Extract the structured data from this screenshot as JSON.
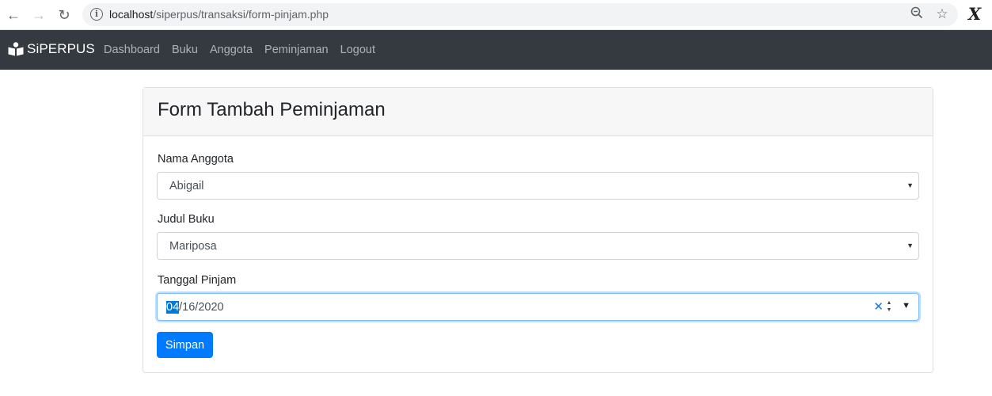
{
  "browser": {
    "url_host": "localhost",
    "url_path": "/siperpus/transaksi/form-pinjam.php"
  },
  "navbar": {
    "brand": "SiPERPUS",
    "links": [
      "Dashboard",
      "Buku",
      "Anggota",
      "Peminjaman",
      "Logout"
    ]
  },
  "form": {
    "title": "Form Tambah Peminjaman",
    "member_label": "Nama Anggota",
    "member_value": "Abigail",
    "book_label": "Judul Buku",
    "book_value": "Mariposa",
    "date_label": "Tanggal Pinjam",
    "date_month": "04",
    "date_rest": "/16/2020",
    "submit_label": "Simpan"
  },
  "colors": {
    "navbar_bg": "#343a40",
    "primary": "#007bff",
    "focus_border": "#80bdff"
  }
}
